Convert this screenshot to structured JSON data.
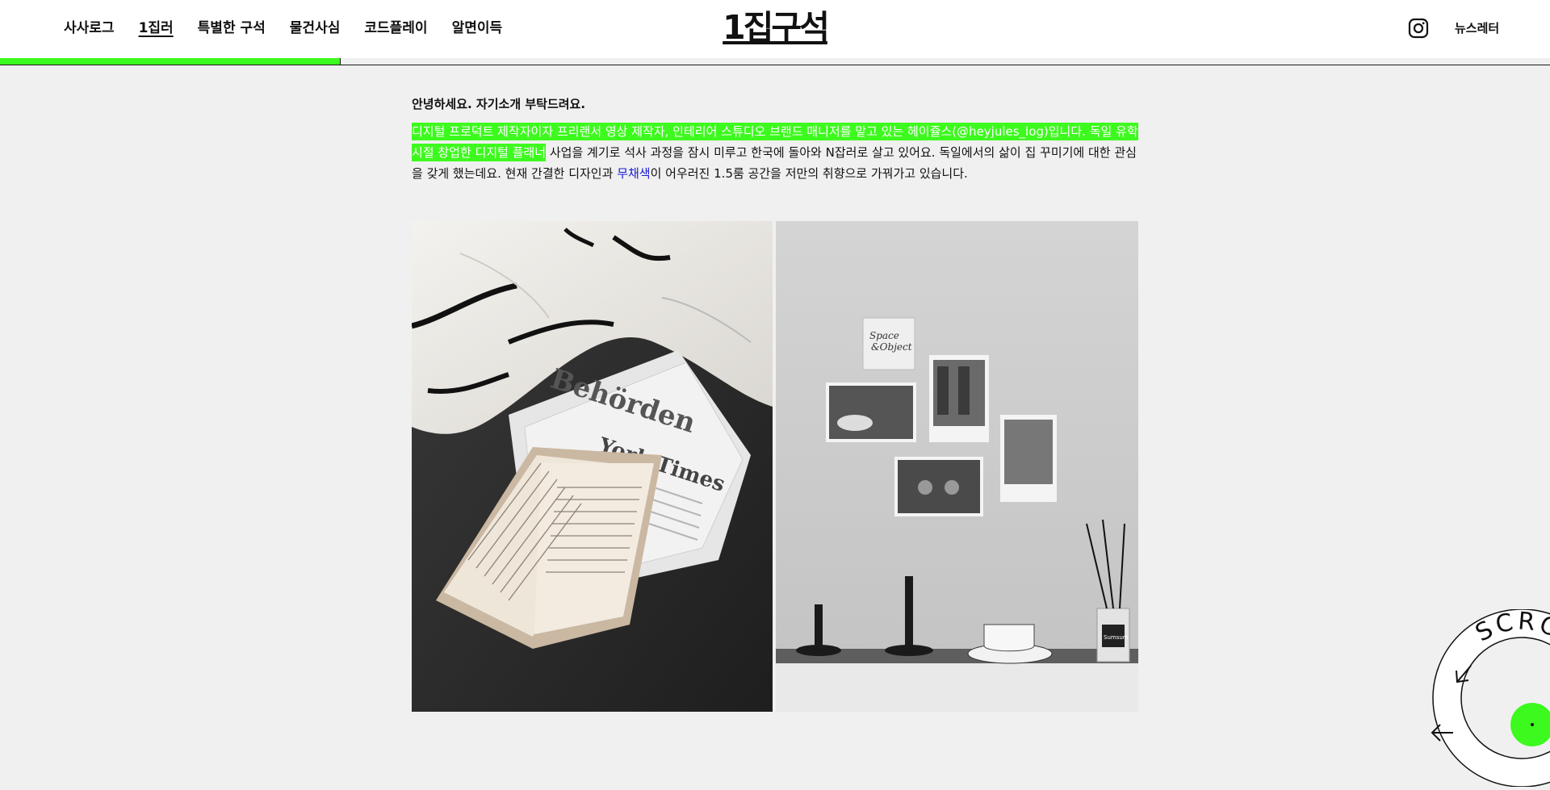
{
  "header": {
    "nav": [
      {
        "label": "사사로그"
      },
      {
        "label": "1집러"
      },
      {
        "label": "특별한 구석"
      },
      {
        "label": "물건사심"
      },
      {
        "label": "코드플레이"
      },
      {
        "label": "알면이득"
      }
    ],
    "logo": "1집구석",
    "instagram_icon": "instagram-icon",
    "newsletter_label": "뉴스레터"
  },
  "reading_progress": 0.22,
  "colors": {
    "accent": "#3dfa1e",
    "link_blue": "#1a1ad6",
    "background": "#f0f0f0",
    "text": "#111111"
  },
  "article": {
    "question": "안녕하세요. 자기소개 부탁드려요.",
    "answer_highlight": "디지털 프로덕트 제작자이자 프리랜서 영상 제작자, 인테리어 스튜디오 브랜드 매니저를 맡고 있는 헤이쥴스(@heyjules_log)입니다. 독일 유학 시절 창업한 디지털 플래너",
    "answer_part1": " 사업을 계기로 석사 과정을 잠시 미루고 한국에 돌아와 N잡러로 살고 있어요. 독일에서의 삶이 집 꾸미기에 대한 관심을 갖게 했는데요. 현재 간결한 디자인과 ",
    "answer_link": "무채색",
    "answer_part2": "이 어우러진 1.5룸 공간을 저만의 취향으로 가꿔가고 있습니다."
  },
  "photos": {
    "left": {
      "newspaper_title_1": "Behörden",
      "newspaper_title_2": "York Times"
    },
    "right": {
      "card_line1": "Space",
      "card_line2": "&Object",
      "bottle_label": "Sumsum"
    }
  },
  "scroll_badge": {
    "text": "SCROLL",
    "arrow_icon": "arrow-up-left-icon"
  }
}
